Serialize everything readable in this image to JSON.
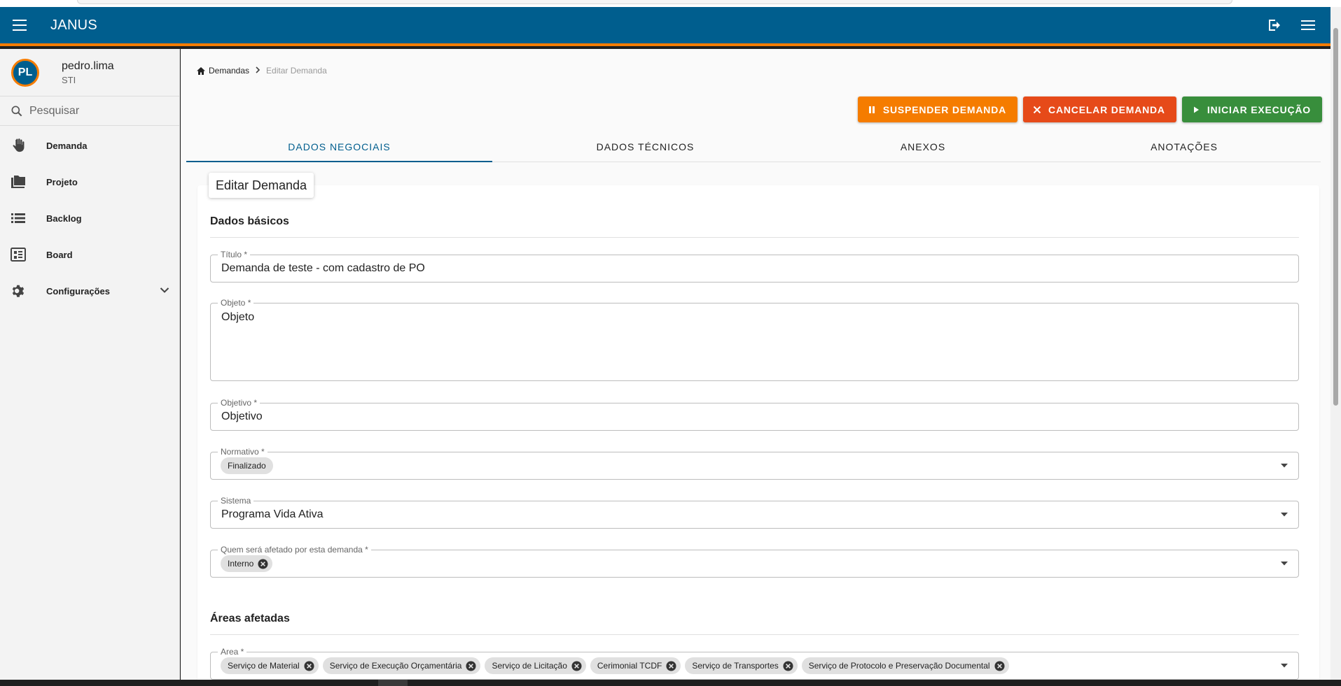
{
  "appbar": {
    "title": "JANUS",
    "icons": [
      "menu-icon",
      "logout-icon",
      "more-menu-icon"
    ]
  },
  "user": {
    "initials": "PL",
    "name": "pedro.lima",
    "org": "STI"
  },
  "search": {
    "placeholder": "Pesquisar"
  },
  "sidebar": {
    "items": [
      {
        "label": "Demanda",
        "icon": "hand-icon"
      },
      {
        "label": "Projeto",
        "icon": "folder-icon"
      },
      {
        "label": "Backlog",
        "icon": "list-icon"
      },
      {
        "label": "Board",
        "icon": "board-icon"
      },
      {
        "label": "Configurações",
        "icon": "gear-icon"
      }
    ]
  },
  "breadcrumb": {
    "home": "Demandas",
    "current": "Editar Demanda"
  },
  "actions": {
    "suspend": "SUSPENDER DEMANDA",
    "cancel": "CANCELAR DEMANDA",
    "start": "INICIAR EXECUÇÃO"
  },
  "colors": {
    "primary": "#005e8e",
    "accent": "#f57c00",
    "suspend": "#f57c00",
    "cancel": "#e64a19",
    "start": "#388e3c"
  },
  "tabs": [
    {
      "label": "DADOS NEGOCIAIS",
      "active": true
    },
    {
      "label": "DADOS TÉCNICOS",
      "active": false
    },
    {
      "label": "ANEXOS",
      "active": false
    },
    {
      "label": "ANOTAÇÕES",
      "active": false
    }
  ],
  "form": {
    "card_title": "Editar Demanda",
    "section_basic": "Dados básicos",
    "titulo": {
      "label": "Título *",
      "value": "Demanda de teste - com cadastro de PO"
    },
    "objeto": {
      "label": "Objeto *",
      "value": "Objeto"
    },
    "objetivo": {
      "label": "Objetivo *",
      "value": "Objetivo"
    },
    "normativo": {
      "label": "Normativo *",
      "chips": [
        "Finalizado"
      ]
    },
    "sistema": {
      "label": "Sistema",
      "value": "Programa Vida Ativa"
    },
    "afetados": {
      "label": "Quem será afetado por esta demanda *",
      "chips": [
        "Interno"
      ]
    },
    "section_areas": "Áreas afetadas",
    "area": {
      "label": "Area *",
      "chips": [
        "Serviço de Material",
        "Serviço de Execução Orçamentária",
        "Serviço de Licitação",
        "Cerimonial TCDF",
        "Serviço de Transportes",
        "Serviço de Protocolo e Preservação Documental"
      ]
    }
  }
}
